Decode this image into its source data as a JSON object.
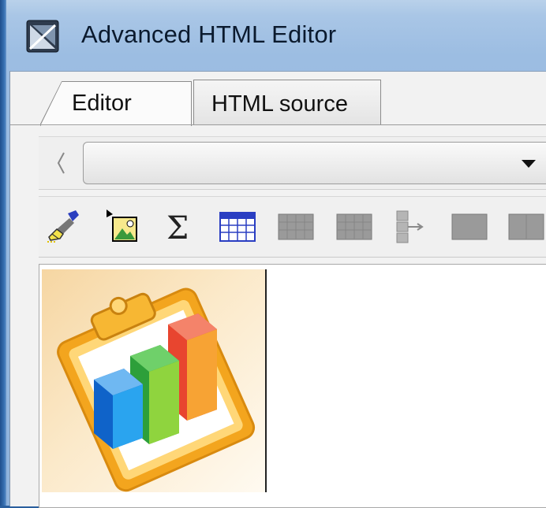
{
  "window": {
    "title": "Advanced HTML Editor",
    "icon": "magicdraw-app-icon"
  },
  "tabs": [
    {
      "label": "Editor",
      "selected": true
    },
    {
      "label": "HTML source",
      "selected": false
    }
  ],
  "style_combo": {
    "value": ""
  },
  "toolbar": {
    "buttons": [
      {
        "icon": "paint-brush-icon",
        "enabled": true
      },
      {
        "icon": "insert-image-icon",
        "enabled": true
      },
      {
        "icon": "sigma-icon",
        "enabled": true
      },
      {
        "icon": "insert-table-icon",
        "enabled": true
      },
      {
        "icon": "table-row-icon",
        "enabled": false
      },
      {
        "icon": "table-column-icon",
        "enabled": false
      },
      {
        "icon": "tree-structure-icon",
        "enabled": false
      },
      {
        "icon": "table-cell-icon",
        "enabled": false
      },
      {
        "icon": "table-merge-icon",
        "enabled": false
      }
    ]
  },
  "editor": {
    "image": "clipboard-bar-chart-image"
  },
  "colors": {
    "accent": "#2a5f9e",
    "chart_blue": "#1f8fe0",
    "chart_green": "#3cb44a",
    "chart_red": "#e43a2e",
    "clipboard_gold": "#f2a71f"
  }
}
